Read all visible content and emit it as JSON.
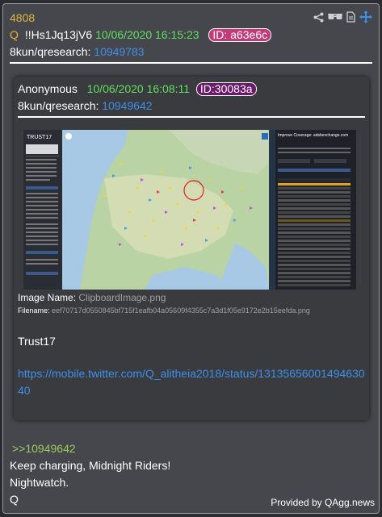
{
  "post": {
    "number": "4808",
    "q_marker": "Q",
    "tripcode": "!!Hs1Jq13jV6",
    "timestamp": "10/06/2020 16:15:23",
    "id_label": "ID: a63e6c",
    "board_prefix": "8kun/qresearch: ",
    "board_ref": "10949783",
    "id_badge_color": "#c23a78"
  },
  "quoted": {
    "author": "Anonymous",
    "timestamp": "10/06/2020 16:08:11",
    "id_label": "ID:30083a",
    "id_badge_color": "#6a1a6a",
    "board_prefix": "8kun/qresearch: ",
    "board_ref": "10949642",
    "image": {
      "name_label": "Image Name: ",
      "name_value": "ClipboardImage.png",
      "filename_label": "Filename: ",
      "filename_value": "eef70717d0550845bf715f1eafb04a05609f4355c7a3d1f05e9172e2b15eefda.png",
      "panel_title": "TRUST17",
      "right_panel_title": "Improve Coverage: adsbexchange.com"
    },
    "text": "Trust17",
    "link": "https://mobile.twitter.com/Q_alitheia2018/status/1313565600149463040"
  },
  "reply_ref": ">>10949642",
  "body_lines": [
    "Keep charging, Midnight Riders!",
    "Nightwatch.",
    "Q"
  ],
  "footer": "Provided by QAgg.news",
  "icons": [
    "share-icon",
    "glasses-icon",
    "document-icon",
    "move-icon"
  ],
  "colors": {
    "number": "#e0b341",
    "green": "#5ee05e",
    "link": "#3d8fe8",
    "reply": "#9acd5e"
  }
}
